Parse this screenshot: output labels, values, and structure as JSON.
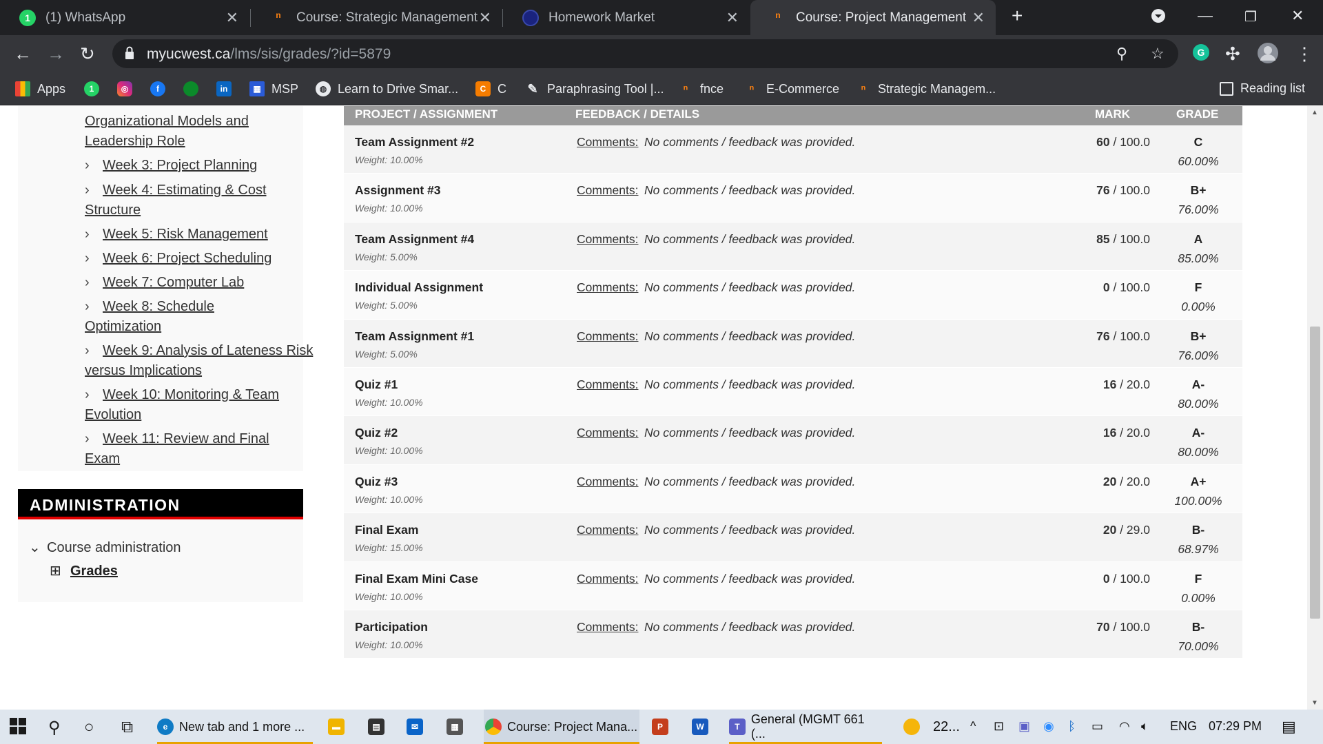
{
  "browser": {
    "tabs": [
      {
        "title": "(1) WhatsApp",
        "icon": "whatsapp-icon",
        "active": false
      },
      {
        "title": "Course: Strategic Management",
        "icon": "moodle-icon",
        "active": false
      },
      {
        "title": "Homework Market",
        "icon": "homework-market-icon",
        "active": false
      },
      {
        "title": "Course: Project Management",
        "icon": "moodle-icon",
        "active": true
      }
    ],
    "url_domain": "myucwest.ca",
    "url_path": "/lms/sis/grades/?id=5879",
    "bookmarks": [
      {
        "label": "Apps",
        "icon": "apps-grid-icon"
      },
      {
        "label": "",
        "icon": "whatsapp-icon"
      },
      {
        "label": "",
        "icon": "instagram-icon"
      },
      {
        "label": "",
        "icon": "facebook-icon"
      },
      {
        "label": "",
        "icon": "green-circle-icon"
      },
      {
        "label": "",
        "icon": "linkedin-icon"
      },
      {
        "label": "MSP",
        "icon": "msp-icon"
      },
      {
        "label": "Learn to Drive Smar...",
        "icon": "globe-icon"
      },
      {
        "label": "C",
        "icon": "c-orange-icon"
      },
      {
        "label": "Paraphrasing Tool |...",
        "icon": "quill-icon"
      },
      {
        "label": "fnce",
        "icon": "moodle-icon"
      },
      {
        "label": "E-Commerce",
        "icon": "moodle-icon"
      },
      {
        "label": "Strategic Managem...",
        "icon": "moodle-icon"
      }
    ],
    "reading_list": "Reading list"
  },
  "sidebar": {
    "partial_item": "Organizational Models and Leadership Role",
    "weeks": [
      "Week 3: Project Planning",
      "Week 4: Estimating & Cost Structure",
      "Week 5: Risk Management",
      "Week 6: Project Scheduling",
      "Week 7: Computer Lab",
      "Week 8: Schedule Optimization",
      "Week 9: Analysis of Lateness Risk versus Implications",
      "Week 10: Monitoring & Team Evolution",
      "Week 11: Review and Final Exam"
    ],
    "admin_title": "ADMINISTRATION",
    "course_admin": "Course administration",
    "grades_link": "Grades"
  },
  "table": {
    "headers": {
      "project": "PROJECT / ASSIGNMENT",
      "feedback": "FEEDBACK / DETAILS",
      "mark": "MARK",
      "grade": "GRADE"
    },
    "comment_label": "Comments:",
    "rows": [
      {
        "name": "Team Assignment #2",
        "weight": "Weight: 10.00%",
        "comment": "No comments / feedback was provided.",
        "mark": "60",
        "out_of": "/ 100.0",
        "grade": "C",
        "percent": "60.00%"
      },
      {
        "name": "Assignment #3",
        "weight": "Weight: 10.00%",
        "comment": "No comments / feedback was provided.",
        "mark": "76",
        "out_of": "/ 100.0",
        "grade": "B+",
        "percent": "76.00%"
      },
      {
        "name": "Team Assignment #4",
        "weight": "Weight: 5.00%",
        "comment": "No comments / feedback was provided.",
        "mark": "85",
        "out_of": "/ 100.0",
        "grade": "A",
        "percent": "85.00%"
      },
      {
        "name": "Individual Assignment",
        "weight": "Weight: 5.00%",
        "comment": "No comments / feedback was provided.",
        "mark": "0",
        "out_of": "/ 100.0",
        "grade": "F",
        "percent": "0.00%"
      },
      {
        "name": "Team Assignment #1",
        "weight": "Weight: 5.00%",
        "comment": "No comments / feedback was provided.",
        "mark": "76",
        "out_of": "/ 100.0",
        "grade": "B+",
        "percent": "76.00%"
      },
      {
        "name": "Quiz #1",
        "weight": "Weight: 10.00%",
        "comment": "No comments / feedback was provided.",
        "mark": "16",
        "out_of": "/ 20.0",
        "grade": "A-",
        "percent": "80.00%"
      },
      {
        "name": "Quiz #2",
        "weight": "Weight: 10.00%",
        "comment": "No comments / feedback was provided.",
        "mark": "16",
        "out_of": "/ 20.0",
        "grade": "A-",
        "percent": "80.00%"
      },
      {
        "name": "Quiz #3",
        "weight": "Weight: 10.00%",
        "comment": "No comments / feedback was provided.",
        "mark": "20",
        "out_of": "/ 20.0",
        "grade": "A+",
        "percent": "100.00%"
      },
      {
        "name": "Final Exam",
        "weight": "Weight: 15.00%",
        "comment": "No comments / feedback was provided.",
        "mark": "20",
        "out_of": "/ 29.0",
        "grade": "B-",
        "percent": "68.97%"
      },
      {
        "name": "Final Exam Mini Case",
        "weight": "Weight: 10.00%",
        "comment": "No comments / feedback was provided.",
        "mark": "0",
        "out_of": "/ 100.0",
        "grade": "F",
        "percent": "0.00%"
      },
      {
        "name": "Participation",
        "weight": "Weight: 10.00%",
        "comment": "No comments / feedback was provided.",
        "mark": "70",
        "out_of": "/ 100.0",
        "grade": "B-",
        "percent": "70.00%"
      }
    ]
  },
  "taskbar": {
    "apps": [
      {
        "label": "New tab and 1 more ...",
        "icon": "edge-icon"
      },
      {
        "label": "",
        "icon": "file-explorer-icon"
      },
      {
        "label": "",
        "icon": "store-icon"
      },
      {
        "label": "",
        "icon": "mail-icon"
      },
      {
        "label": "",
        "icon": "calculator-icon"
      },
      {
        "label": "Course: Project Mana...",
        "icon": "chrome-icon"
      },
      {
        "label": "",
        "icon": "powerpoint-icon"
      },
      {
        "label": "",
        "icon": "word-icon"
      },
      {
        "label": "General (MGMT 661 (...",
        "icon": "teams-icon"
      }
    ],
    "weather": "22...",
    "language": "ENG",
    "time": "07:29 PM"
  },
  "colors": {
    "chrome_dark": "#202124",
    "chrome_toolbar": "#35363a",
    "table_header": "#9a9a9a",
    "admin_accent": "#e10000",
    "taskbar": "#dfe6ee"
  }
}
